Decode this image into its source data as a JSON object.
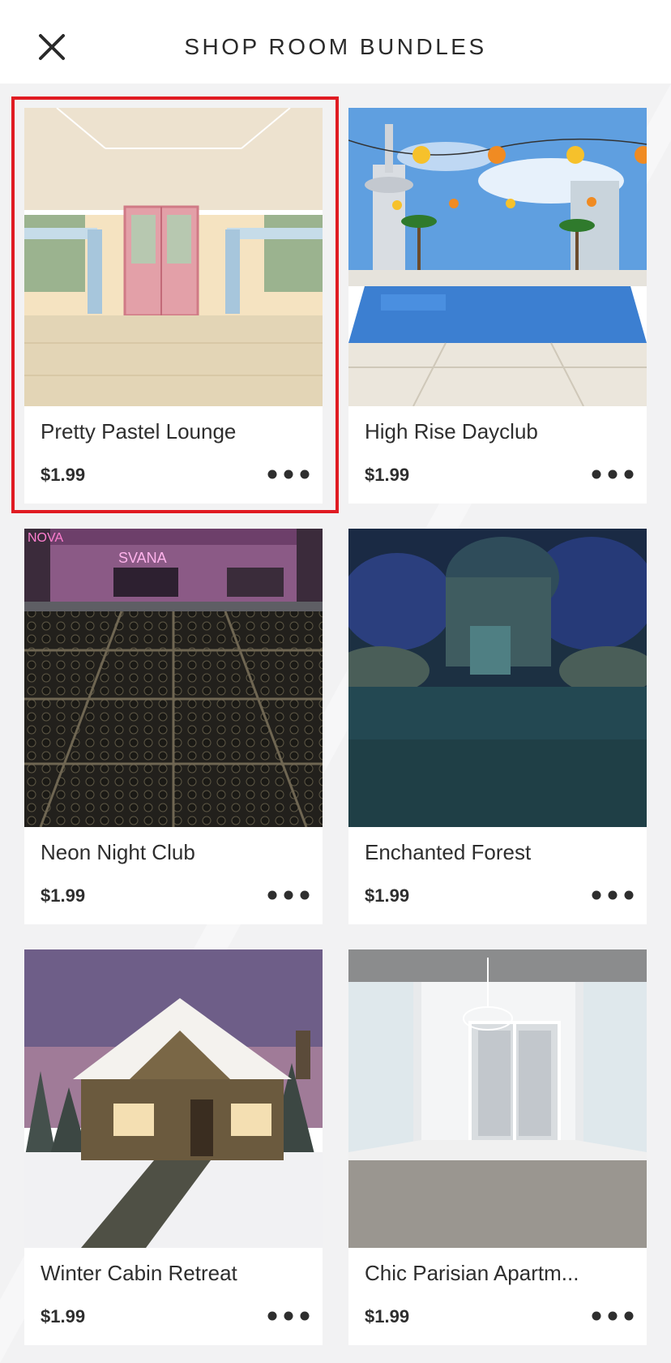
{
  "header": {
    "title": "SHOP ROOM BUNDLES",
    "close_icon": "close-icon"
  },
  "bundles": [
    {
      "name": "Pretty Pastel Lounge",
      "price": "$1.99",
      "selected": true
    },
    {
      "name": "High Rise Dayclub",
      "price": "$1.99",
      "selected": false
    },
    {
      "name": "Neon Night Club",
      "price": "$1.99",
      "selected": false
    },
    {
      "name": "Enchanted Forest",
      "price": "$1.99",
      "selected": false
    },
    {
      "name": "Winter Cabin Retreat",
      "price": "$1.99",
      "selected": false
    },
    {
      "name": "Chic Parisian Apartm...",
      "price": "$1.99",
      "selected": false
    }
  ],
  "colors": {
    "selection_outline": "#e01b22",
    "background": "#f2f2f3",
    "card": "#ffffff",
    "text": "#2e2e2e"
  },
  "icons": {
    "more": "more-options-icon"
  },
  "images": {
    "sign_neon_left": "NOVA",
    "sign_neon_center": "SVANA"
  }
}
